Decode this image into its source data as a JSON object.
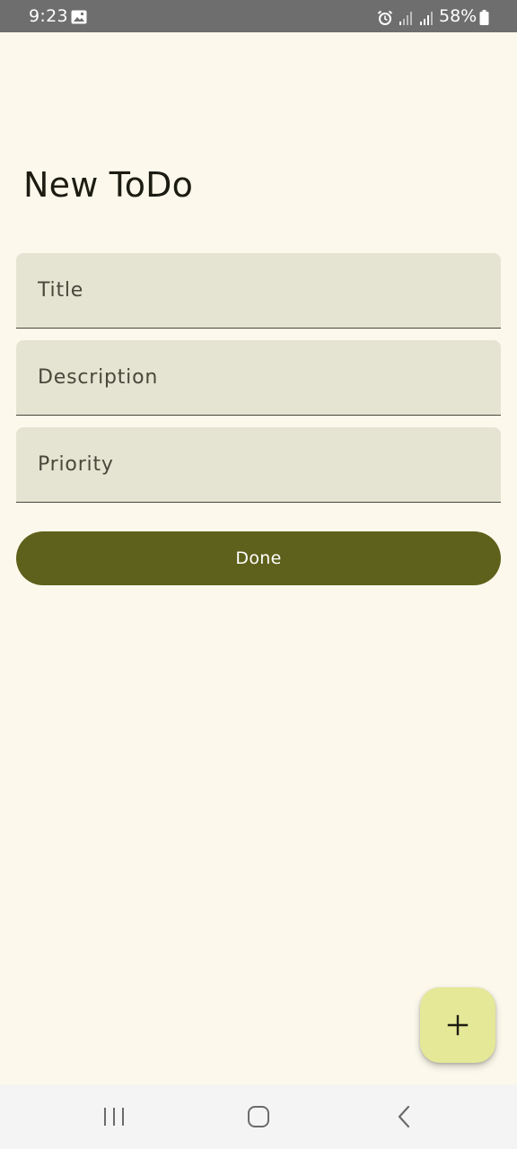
{
  "status_bar": {
    "time": "9:23",
    "battery_text": "58%",
    "icons": [
      "gallery-icon",
      "alarm-icon",
      "signal-icon",
      "signal-icon",
      "battery-icon"
    ]
  },
  "screen": {
    "title": "New ToDo"
  },
  "form": {
    "title_field": {
      "placeholder": "Title",
      "value": ""
    },
    "description_field": {
      "placeholder": "Description",
      "value": ""
    },
    "priority_field": {
      "placeholder": "Priority",
      "value": ""
    },
    "done_label": "Done"
  },
  "fab": {
    "icon": "plus-icon"
  },
  "nav_bar": {
    "icons": [
      "recent-apps-icon",
      "home-icon",
      "back-icon"
    ]
  },
  "colors": {
    "background": "#fcf9ec",
    "field_background": "#e5e3d2",
    "primary": "#5e611b",
    "fab_background": "#e5e897",
    "status_bar": "#6e6e6e"
  }
}
